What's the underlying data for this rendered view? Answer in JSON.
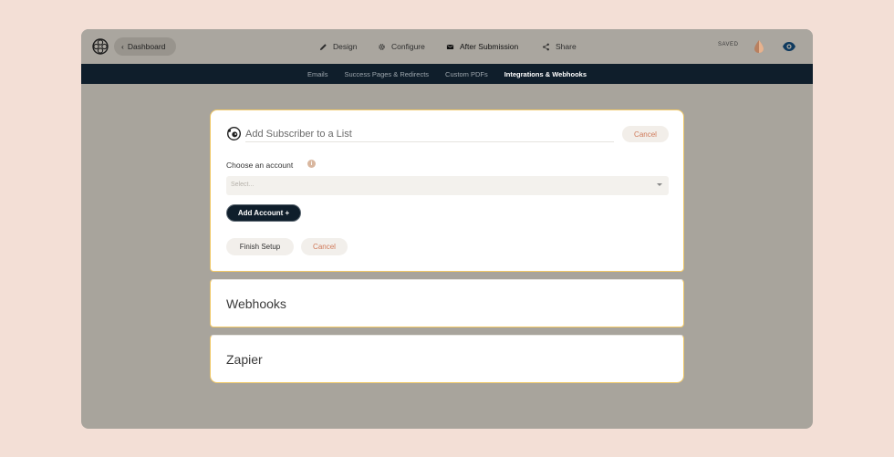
{
  "topbar": {
    "back_label": "Dashboard",
    "back_chevron": "‹",
    "nav": [
      {
        "label": "Design",
        "icon": "pencil-icon"
      },
      {
        "label": "Configure",
        "icon": "gear-icon"
      },
      {
        "label": "After Submission",
        "icon": "envelope-icon"
      },
      {
        "label": "Share",
        "icon": "share-icon"
      }
    ],
    "status": "SAVED"
  },
  "subnav": {
    "items": [
      "Emails",
      "Success Pages & Redirects",
      "Custom PDFs",
      "Integrations & Webhooks"
    ],
    "active": "Integrations & Webhooks"
  },
  "integration": {
    "title_value": "Add Subscriber to a List",
    "cancel_label": "Cancel",
    "account_label": "Choose an account",
    "info_glyph": "i",
    "select_placeholder": "Select...",
    "add_account_label": "Add Account +",
    "finish_label": "Finish Setup",
    "cancel_bottom_label": "Cancel"
  },
  "sections": {
    "webhooks": "Webhooks",
    "zapier": "Zapier"
  },
  "colors": {
    "background": "#f3dfd6",
    "navy": "#0f1e2b",
    "accent_border": "#f1c866",
    "cancel_text": "#d07a5a",
    "eye_icon": "#0f3a5f"
  }
}
